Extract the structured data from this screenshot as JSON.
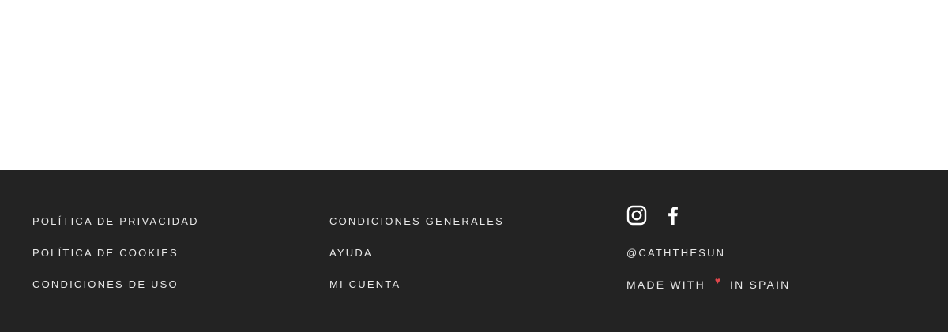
{
  "footer": {
    "column_1": {
      "links": [
        {
          "label": "POLÍTICA DE PRIVACIDAD"
        },
        {
          "label": "POLÍTICA DE COOKIES"
        },
        {
          "label": "CONDICIONES DE USO"
        }
      ]
    },
    "column_2": {
      "links": [
        {
          "label": "CONDICIONES GENERALES"
        },
        {
          "label": "AYUDA"
        },
        {
          "label": "MI CUENTA"
        }
      ]
    },
    "column_3": {
      "social_icons": [
        "instagram-icon",
        "facebook-icon"
      ],
      "handle": "@CATHTHESUN",
      "made_with_prefix": "MADE WITH",
      "heart": "♥",
      "made_with_suffix": "IN SPAIN"
    },
    "colors": {
      "background": "#232323",
      "text": "#e9e9e9",
      "heart": "#e0474c"
    }
  }
}
